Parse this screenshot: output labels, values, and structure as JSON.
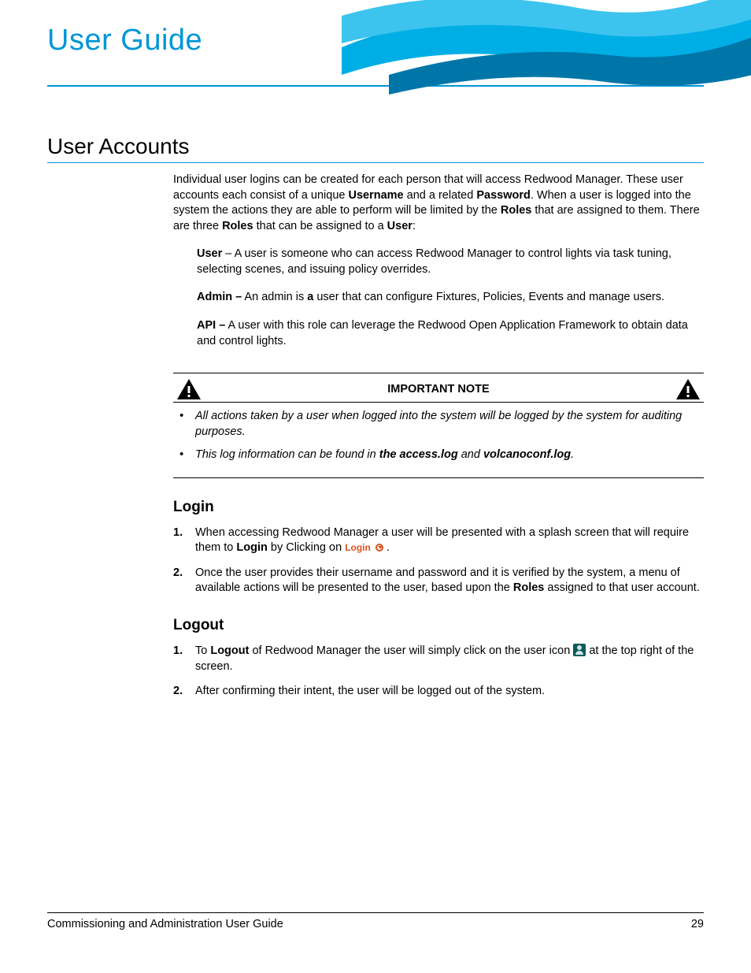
{
  "header": {
    "doc_title": "User Guide"
  },
  "page_title": "User Accounts",
  "intro": {
    "p1a": "Individual user logins can be created for each person that will access Redwood Manager. These user accounts each consist of a unique ",
    "b1": "Username",
    "p1b": " and a related ",
    "b2": "Password",
    "p1c": ". When a user is logged into the system the actions they are able to perform will be limited by the ",
    "b3": "Roles",
    "p1d": " that are assigned to them. There are three ",
    "b4": "Roles",
    "p1e": " that can be assigned to a ",
    "b5": "User",
    "p1f": ":"
  },
  "roles": {
    "user_b": "User",
    "user_t": " – A user is someone who can access Redwood Manager to control lights via task tuning, selecting scenes, and issuing policy overrides.",
    "admin_b": "Admin –",
    "admin_t1": " An admin is ",
    "admin_b2": "a",
    "admin_t2": " user that can configure Fixtures, Policies, Events and manage users.",
    "api_b": "API –",
    "api_t": " A user with this role can leverage the Redwood Open Application Framework to obtain data and control lights."
  },
  "note": {
    "title": "IMPORTANT NOTE",
    "li1": "All actions taken by a user when logged into the system will be logged by the system for auditing purposes.",
    "li2a": "This log information can be found in ",
    "li2b1": "the access.log",
    "li2mid": " and ",
    "li2b2": "volcanoconf.log",
    "li2end": "."
  },
  "login": {
    "title": "Login",
    "s1n": "1.",
    "s1a": "When accessing Redwood Manager a user will be presented with a splash screen that will require them to ",
    "s1b": "Login",
    "s1c": " by Clicking on  ",
    "s1btn": "Login",
    "s1d": " .",
    "s2n": "2.",
    "s2a": "Once the user provides their username and password and it is verified by the system, a menu of available actions will be presented to the user, based upon the ",
    "s2b": "Roles",
    "s2c": " assigned to that user account."
  },
  "logout": {
    "title": "Logout",
    "s1n": "1.",
    "s1a": "To ",
    "s1b": "Logout",
    "s1c": " of Redwood Manager the user will simply click on the user icon ",
    "s1d": " at the top right of the screen.",
    "s2n": "2.",
    "s2t": "After confirming their intent, the user will be logged out of the system."
  },
  "footer": {
    "left": "Commissioning and Administration User Guide",
    "right": "29"
  }
}
